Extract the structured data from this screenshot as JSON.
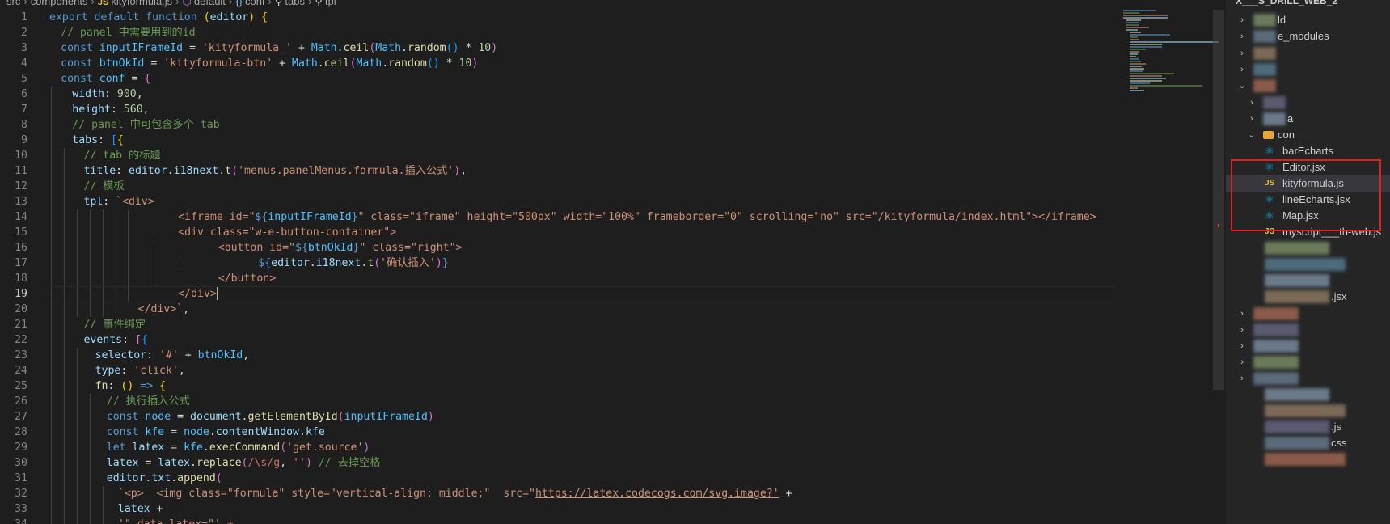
{
  "breadcrumb": [
    "src",
    "components",
    "kityformula.js",
    "default",
    "conf",
    "tabs",
    "tpl"
  ],
  "editor": {
    "current_line": 19,
    "lines": [
      {
        "n": "1",
        "indent": 0,
        "tokens": [
          [
            "kb",
            "export"
          ],
          [
            "p",
            " "
          ],
          [
            "kb",
            "default"
          ],
          [
            "p",
            " "
          ],
          [
            "kb",
            "function"
          ],
          [
            "p",
            " "
          ],
          [
            "y",
            "("
          ],
          [
            "v",
            "editor"
          ],
          [
            "y",
            ")"
          ],
          [
            "p",
            " "
          ],
          [
            "y",
            "{"
          ]
        ]
      },
      {
        "n": "2",
        "indent": 1,
        "tokens": [
          [
            "cm",
            "// panel 中需要用到的id"
          ]
        ]
      },
      {
        "n": "3",
        "indent": 1,
        "tokens": [
          [
            "kb",
            "const"
          ],
          [
            "p",
            " "
          ],
          [
            "c",
            "inputIFrameId"
          ],
          [
            "p",
            " = "
          ],
          [
            "s",
            "'kityformula_'"
          ],
          [
            "p",
            " + "
          ],
          [
            "c",
            "Math"
          ],
          [
            "p",
            "."
          ],
          [
            "f",
            "ceil"
          ],
          [
            "pu",
            "("
          ],
          [
            "c",
            "Math"
          ],
          [
            "p",
            "."
          ],
          [
            "f",
            "random"
          ],
          [
            "bl",
            "()"
          ],
          [
            "p",
            " * "
          ],
          [
            "n",
            "10"
          ],
          [
            "pu",
            ")"
          ]
        ]
      },
      {
        "n": "4",
        "indent": 1,
        "tokens": [
          [
            "kb",
            "const"
          ],
          [
            "p",
            " "
          ],
          [
            "c",
            "btnOkId"
          ],
          [
            "p",
            " = "
          ],
          [
            "s",
            "'kityformula-btn'"
          ],
          [
            "p",
            " + "
          ],
          [
            "c",
            "Math"
          ],
          [
            "p",
            "."
          ],
          [
            "f",
            "ceil"
          ],
          [
            "pu",
            "("
          ],
          [
            "c",
            "Math"
          ],
          [
            "p",
            "."
          ],
          [
            "f",
            "random"
          ],
          [
            "bl",
            "()"
          ],
          [
            "p",
            " * "
          ],
          [
            "n",
            "10"
          ],
          [
            "pu",
            ")"
          ]
        ]
      },
      {
        "n": "5",
        "indent": 1,
        "tokens": [
          [
            "kb",
            "const"
          ],
          [
            "p",
            " "
          ],
          [
            "c",
            "conf"
          ],
          [
            "p",
            " = "
          ],
          [
            "pu",
            "{"
          ]
        ]
      },
      {
        "n": "6",
        "indent": 2,
        "tokens": [
          [
            "v",
            "width"
          ],
          [
            "p",
            ": "
          ],
          [
            "n",
            "900"
          ],
          [
            "p",
            ","
          ]
        ]
      },
      {
        "n": "7",
        "indent": 2,
        "tokens": [
          [
            "v",
            "height"
          ],
          [
            "p",
            ": "
          ],
          [
            "n",
            "560"
          ],
          [
            "p",
            ","
          ]
        ]
      },
      {
        "n": "8",
        "indent": 2,
        "tokens": [
          [
            "cm",
            "// panel 中可包含多个 tab"
          ]
        ]
      },
      {
        "n": "9",
        "indent": 2,
        "tokens": [
          [
            "v",
            "tabs"
          ],
          [
            "p",
            ": "
          ],
          [
            "bl",
            "["
          ],
          [
            "y",
            "{"
          ]
        ]
      },
      {
        "n": "10",
        "indent": 3,
        "tokens": [
          [
            "cm",
            "// tab 的标题"
          ]
        ]
      },
      {
        "n": "11",
        "indent": 3,
        "tokens": [
          [
            "v",
            "title"
          ],
          [
            "p",
            ": "
          ],
          [
            "v",
            "editor"
          ],
          [
            "p",
            "."
          ],
          [
            "v",
            "i18next"
          ],
          [
            "p",
            "."
          ],
          [
            "f",
            "t"
          ],
          [
            "pu",
            "("
          ],
          [
            "s",
            "'menus.panelMenus.formula.插入公式'"
          ],
          [
            "pu",
            ")"
          ],
          [
            "p",
            ","
          ]
        ]
      },
      {
        "n": "12",
        "indent": 3,
        "tokens": [
          [
            "cm",
            "// 模板"
          ]
        ]
      },
      {
        "n": "13",
        "indent": 3,
        "tokens": [
          [
            "v",
            "tpl"
          ],
          [
            "p",
            ": "
          ],
          [
            "s",
            "`<div>"
          ]
        ]
      },
      {
        "n": "14",
        "indent": 9,
        "tokens": [
          [
            "s",
            "<iframe id=\""
          ],
          [
            "kb",
            "${"
          ],
          [
            "c",
            "inputIFrameId"
          ],
          [
            "kb",
            "}"
          ],
          [
            "s",
            "\" class=\"iframe\" height=\"500px\" width=\"100%\" frameborder=\"0\" scrolling=\"no\" src=\"/kityformula/index.html\"></iframe>"
          ]
        ]
      },
      {
        "n": "15",
        "indent": 9,
        "tokens": [
          [
            "s",
            "<div class=\"w-e-button-container\">"
          ]
        ]
      },
      {
        "n": "16",
        "indent": 11,
        "tokens": [
          [
            "s",
            "<button id=\""
          ],
          [
            "kb",
            "${"
          ],
          [
            "c",
            "btnOkId"
          ],
          [
            "kb",
            "}"
          ],
          [
            "s",
            "\" class=\"right\">"
          ]
        ]
      },
      {
        "n": "17",
        "indent": 13,
        "tokens": [
          [
            "kb",
            "${"
          ],
          [
            "v",
            "editor"
          ],
          [
            "p",
            "."
          ],
          [
            "v",
            "i18next"
          ],
          [
            "p",
            "."
          ],
          [
            "f",
            "t"
          ],
          [
            "pu",
            "("
          ],
          [
            "s",
            "'确认插入'"
          ],
          [
            "pu",
            ")"
          ],
          [
            "kb",
            "}"
          ]
        ]
      },
      {
        "n": "18",
        "indent": 11,
        "tokens": [
          [
            "s",
            "</button>"
          ]
        ]
      },
      {
        "n": "19",
        "indent": 9,
        "tokens": [
          [
            "s",
            "</div>"
          ]
        ],
        "cursor": true
      },
      {
        "n": "20",
        "indent": 7,
        "tokens": [
          [
            "s",
            "</div>`"
          ],
          [
            "p",
            ","
          ]
        ]
      },
      {
        "n": "21",
        "indent": 3,
        "tokens": [
          [
            "cm",
            "// 事件绑定"
          ]
        ]
      },
      {
        "n": "22",
        "indent": 3,
        "tokens": [
          [
            "v",
            "events"
          ],
          [
            "p",
            ": "
          ],
          [
            "pu",
            "["
          ],
          [
            "bl",
            "{"
          ]
        ]
      },
      {
        "n": "23",
        "indent": 4,
        "tokens": [
          [
            "v",
            "selector"
          ],
          [
            "p",
            ": "
          ],
          [
            "s",
            "'#'"
          ],
          [
            "p",
            " + "
          ],
          [
            "c",
            "btnOkId"
          ],
          [
            "p",
            ","
          ]
        ]
      },
      {
        "n": "24",
        "indent": 4,
        "tokens": [
          [
            "v",
            "type"
          ],
          [
            "p",
            ": "
          ],
          [
            "s",
            "'click'"
          ],
          [
            "p",
            ","
          ]
        ]
      },
      {
        "n": "25",
        "indent": 4,
        "tokens": [
          [
            "f",
            "fn"
          ],
          [
            "p",
            ": "
          ],
          [
            "y",
            "()"
          ],
          [
            "p",
            " "
          ],
          [
            "kb",
            "=>"
          ],
          [
            "p",
            " "
          ],
          [
            "y",
            "{"
          ]
        ]
      },
      {
        "n": "26",
        "indent": 5,
        "tokens": [
          [
            "cm",
            "// 执行插入公式"
          ]
        ]
      },
      {
        "n": "27",
        "indent": 5,
        "tokens": [
          [
            "kb",
            "const"
          ],
          [
            "p",
            " "
          ],
          [
            "c",
            "node"
          ],
          [
            "p",
            " = "
          ],
          [
            "v",
            "document"
          ],
          [
            "p",
            "."
          ],
          [
            "f",
            "getElementById"
          ],
          [
            "pu",
            "("
          ],
          [
            "c",
            "inputIFrameId"
          ],
          [
            "pu",
            ")"
          ]
        ]
      },
      {
        "n": "28",
        "indent": 5,
        "tokens": [
          [
            "kb",
            "const"
          ],
          [
            "p",
            " "
          ],
          [
            "c",
            "kfe"
          ],
          [
            "p",
            " = "
          ],
          [
            "c",
            "node"
          ],
          [
            "p",
            "."
          ],
          [
            "v",
            "contentWindow"
          ],
          [
            "p",
            "."
          ],
          [
            "v",
            "kfe"
          ]
        ]
      },
      {
        "n": "29",
        "indent": 5,
        "tokens": [
          [
            "kb",
            "let"
          ],
          [
            "p",
            " "
          ],
          [
            "v",
            "latex"
          ],
          [
            "p",
            " = "
          ],
          [
            "c",
            "kfe"
          ],
          [
            "p",
            "."
          ],
          [
            "f",
            "execCommand"
          ],
          [
            "pu",
            "("
          ],
          [
            "s",
            "'get.source'"
          ],
          [
            "pu",
            ")"
          ]
        ]
      },
      {
        "n": "30",
        "indent": 5,
        "tokens": [
          [
            "v",
            "latex"
          ],
          [
            "p",
            " = "
          ],
          [
            "v",
            "latex"
          ],
          [
            "p",
            "."
          ],
          [
            "f",
            "replace"
          ],
          [
            "pu",
            "("
          ],
          [
            "rx",
            "/\\s/g"
          ],
          [
            "p",
            ", "
          ],
          [
            "s",
            "''"
          ],
          [
            "pu",
            ")"
          ],
          [
            "p",
            " "
          ],
          [
            "cm",
            "// 去掉空格"
          ]
        ]
      },
      {
        "n": "31",
        "indent": 5,
        "tokens": [
          [
            "v",
            "editor"
          ],
          [
            "p",
            "."
          ],
          [
            "v",
            "txt"
          ],
          [
            "p",
            "."
          ],
          [
            "f",
            "append"
          ],
          [
            "pu",
            "("
          ]
        ]
      },
      {
        "n": "32",
        "indent": 6,
        "tokens": [
          [
            "s",
            "`<p>  <img class=\"formula\" style=\"vertical-align: middle;\"  src=\""
          ],
          [
            "u",
            "https://latex.codecogs.com/svg.image?'"
          ],
          [
            "p",
            " +"
          ]
        ]
      },
      {
        "n": "33",
        "indent": 6,
        "tokens": [
          [
            "v",
            "latex"
          ],
          [
            "p",
            " +"
          ]
        ]
      },
      {
        "n": "34",
        "indent": 6,
        "tokens": [
          [
            "s",
            "'\" data-latex=\"' +"
          ]
        ]
      }
    ]
  },
  "explorer": {
    "title": "X___S_DRILL_WEB_2",
    "items": [
      {
        "label": "ld",
        "kind": "folder",
        "blurred_prefix": true
      },
      {
        "label": "e_modules",
        "kind": "folder",
        "blurred_prefix": true
      },
      {
        "label": "",
        "kind": "folder",
        "blurred_prefix": true
      },
      {
        "label": "",
        "kind": "folder",
        "blurred_prefix": true
      },
      {
        "label": "",
        "kind": "folder-open",
        "blurred_prefix": true
      },
      {
        "label": "",
        "kind": "folder",
        "blurred_prefix": true
      },
      {
        "label": "a",
        "kind": "folder",
        "blurred_prefix": true
      },
      {
        "label": "con",
        "kind": "folder-open",
        "blurred_prefix": false
      },
      {
        "label": "barEcharts",
        "kind": "react"
      },
      {
        "label": "Editor.jsx",
        "kind": "react"
      },
      {
        "label": "kityformula.js",
        "kind": "js",
        "selected": true
      },
      {
        "label": "lineEcharts.jsx",
        "kind": "react"
      },
      {
        "label": "Map.jsx",
        "kind": "react"
      },
      {
        "label": "myscript___th-web.js",
        "kind": "js"
      },
      {
        "label": "",
        "kind": "blurred"
      },
      {
        "label": "",
        "kind": "blurred"
      },
      {
        "label": "",
        "kind": "blurred"
      },
      {
        "label": ".jsx",
        "kind": "blurred"
      },
      {
        "label": "",
        "kind": "blurred-folder"
      },
      {
        "label": "",
        "kind": "blurred-folder"
      },
      {
        "label": "",
        "kind": "blurred-folder"
      },
      {
        "label": "",
        "kind": "blurred-folder"
      },
      {
        "label": "",
        "kind": "blurred-folder"
      },
      {
        "label": "",
        "kind": "blurred"
      },
      {
        "label": "",
        "kind": "blurred"
      },
      {
        "label": ".js",
        "kind": "blurred"
      },
      {
        "label": "css",
        "kind": "blurred"
      },
      {
        "label": "",
        "kind": "blurred"
      }
    ]
  },
  "colors": {
    "background": "#1e1e1e",
    "sidebar": "#252526",
    "selected_row": "#37373d",
    "highlight_box": "#e02020"
  }
}
